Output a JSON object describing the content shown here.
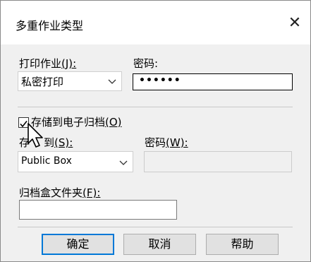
{
  "window": {
    "title": "多重作业类型",
    "close_glyph": "✕"
  },
  "print_job": {
    "label": "打印作业",
    "accel": "(J):",
    "selected": "私密打印"
  },
  "password1": {
    "label": "密码:",
    "value": "••••••"
  },
  "store": {
    "checkbox_label": "存储到电子归档",
    "checkbox_accel": "(O)",
    "checked": true
  },
  "store_to": {
    "label_a": "存",
    "label_b": "到",
    "accel": "(S):",
    "selected": "Public Box"
  },
  "password2": {
    "label": "密码",
    "accel": "(W):"
  },
  "folder": {
    "label": "归档盒文件夹",
    "accel": "(F):",
    "value": ""
  },
  "buttons": {
    "ok": "确定",
    "cancel": "取消",
    "help": "帮助"
  },
  "colors": {
    "accent": "#0078d7",
    "dialog_bg": "#f0f0f0"
  }
}
